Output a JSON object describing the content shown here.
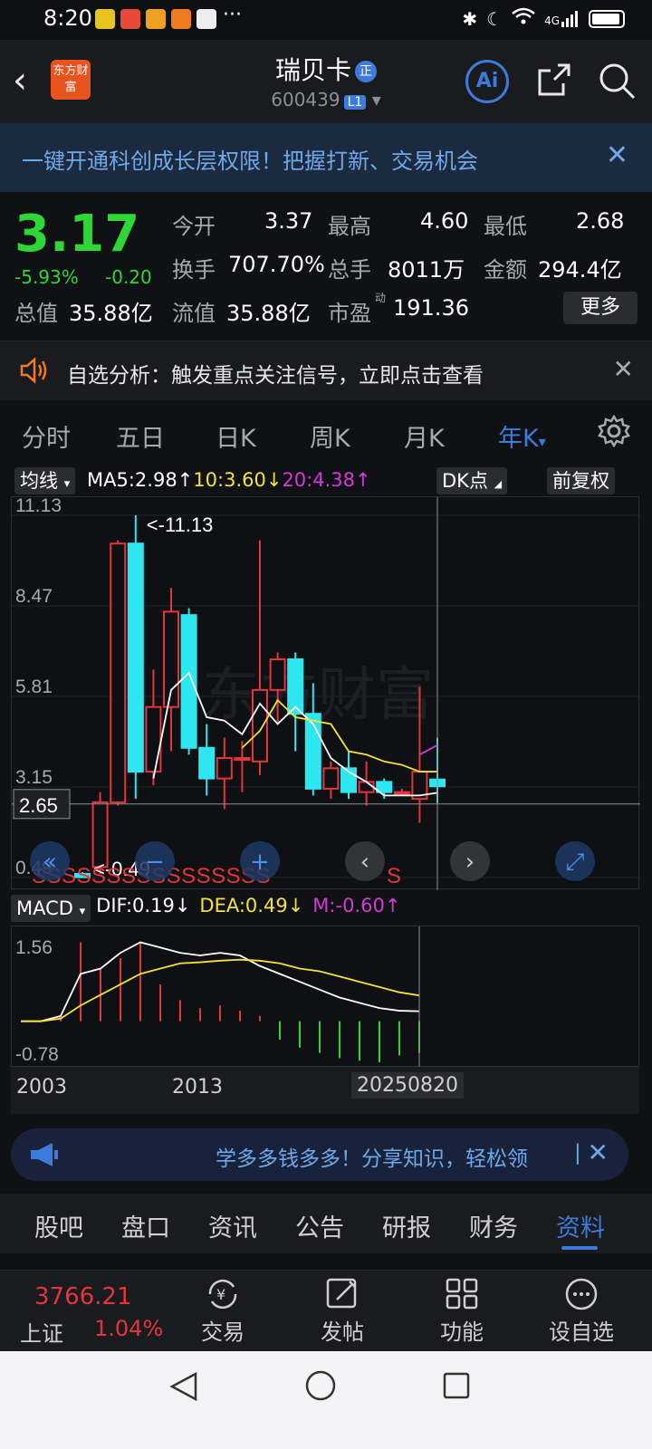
{
  "status": {
    "time": "8:20",
    "dots": "···",
    "signal": "4G"
  },
  "header": {
    "back": "‹",
    "logo": "东方财富",
    "title": "瑞贝卡",
    "zheng_badge": "正",
    "code": "600439",
    "level": "L1",
    "ai_label": "Ai"
  },
  "promo": {
    "text": "一键开通科创成长层权限！把握打新、交易机会",
    "close": "✕"
  },
  "quote": {
    "price": "3.17",
    "change_pct": "-5.93%",
    "change": "-0.20",
    "fields": [
      {
        "label": "今开",
        "value": "3.37"
      },
      {
        "label": "最高",
        "value": "4.60"
      },
      {
        "label": "最低",
        "value": "2.68"
      },
      {
        "label": "换手",
        "value": "707.70%"
      },
      {
        "label": "总手",
        "value": "8011万"
      },
      {
        "label": "金额",
        "value": "294.4亿"
      },
      {
        "label": "总值",
        "value": "35.88亿"
      },
      {
        "label": "流值",
        "value": "35.88亿"
      },
      {
        "label": "市盈",
        "value": "191.36"
      }
    ],
    "pe_sup": "动",
    "more": "更多"
  },
  "alert": {
    "text": "自选分析：触发重点关注信号，立即点击查看",
    "close": "✕"
  },
  "ktabs": [
    "分时",
    "五日",
    "日K",
    "周K",
    "月K",
    "年K"
  ],
  "ktab_active_arrow": "▾",
  "chart_toolbar": {
    "ma_button": "均线",
    "ma5": "MA5:2.98↑",
    "ma10": "10:3.60↓",
    "ma20": "20:4.38↑",
    "dk_button": "DK点",
    "adjust_button": "前复权"
  },
  "chart_data": {
    "type": "candlestick",
    "y_ticks": [
      "11.13",
      "8.47",
      "5.81",
      "3.15",
      "0.49"
    ],
    "ylim": [
      0.49,
      11.13
    ],
    "max_label": "<-11.13",
    "min_label": "<-0.49",
    "crosshair_price": "2.65",
    "candles": [
      {
        "o": 0.6,
        "c": 0.5,
        "h": 0.65,
        "l": 0.49
      },
      {
        "o": 0.8,
        "c": 2.7,
        "h": 3.0,
        "l": 0.6
      },
      {
        "o": 2.7,
        "c": 10.3,
        "h": 10.4,
        "l": 2.6
      },
      {
        "o": 10.3,
        "c": 3.6,
        "h": 11.13,
        "l": 2.8
      },
      {
        "o": 3.6,
        "c": 5.5,
        "h": 6.6,
        "l": 3.2
      },
      {
        "o": 5.5,
        "c": 8.3,
        "h": 9.0,
        "l": 4.2
      },
      {
        "o": 8.2,
        "c": 4.3,
        "h": 8.4,
        "l": 4.1
      },
      {
        "o": 4.3,
        "c": 3.4,
        "h": 5.0,
        "l": 2.9
      },
      {
        "o": 3.4,
        "c": 4.0,
        "h": 4.6,
        "l": 2.5
      },
      {
        "o": 4.0,
        "c": 4.0,
        "h": 4.5,
        "l": 3.0
      },
      {
        "o": 3.9,
        "c": 6.0,
        "h": 10.4,
        "l": 3.5
      },
      {
        "o": 6.0,
        "c": 6.9,
        "h": 7.1,
        "l": 5.0
      },
      {
        "o": 6.9,
        "c": 5.3,
        "h": 7.1,
        "l": 4.2
      },
      {
        "o": 5.3,
        "c": 3.1,
        "h": 6.2,
        "l": 2.9
      },
      {
        "o": 3.1,
        "c": 3.7,
        "h": 3.9,
        "l": 2.8
      },
      {
        "o": 3.7,
        "c": 3.0,
        "h": 4.2,
        "l": 2.8
      },
      {
        "o": 3.0,
        "c": 3.3,
        "h": 3.9,
        "l": 2.6
      },
      {
        "o": 3.3,
        "c": 3.0,
        "h": 3.4,
        "l": 2.8
      },
      {
        "o": 3.0,
        "c": 3.0,
        "h": 3.1,
        "l": 2.9
      },
      {
        "o": 2.8,
        "c": 3.6,
        "h": 6.1,
        "l": 2.1
      },
      {
        "o": 3.37,
        "c": 3.17,
        "h": 4.6,
        "l": 2.68
      }
    ],
    "ma5": [
      null,
      null,
      null,
      null,
      3.4,
      6.0,
      6.5,
      5.2,
      5.1,
      4.7,
      5.6,
      5.0,
      5.5,
      5.0,
      4.0,
      3.6,
      3.3,
      2.9,
      2.9,
      2.9,
      2.98
    ],
    "ma10": [
      null,
      null,
      null,
      null,
      null,
      null,
      null,
      null,
      null,
      4.3,
      4.8,
      5.7,
      5.2,
      5.1,
      5.0,
      4.2,
      4.1,
      3.9,
      3.8,
      3.6,
      3.6
    ],
    "ma20": [
      null,
      null,
      null,
      null,
      null,
      null,
      null,
      null,
      null,
      null,
      null,
      null,
      null,
      null,
      null,
      null,
      null,
      null,
      null,
      4.1,
      4.38
    ],
    "signal_text": "SSSSSSSSSSSSSSSS",
    "signal_last": "S",
    "overlay_icons": [
      "rewind-icon",
      "zoom-out-icon",
      "zoom-in-icon",
      "prev-icon",
      "next-icon",
      "fullscreen-icon"
    ]
  },
  "macd": {
    "button": "MACD",
    "dif": "DIF:0.19↓",
    "dea": "DEA:0.49↓",
    "m": "M:-0.60↑",
    "y_ticks": [
      "1.56",
      "-0.78"
    ],
    "ylim": [
      -0.78,
      1.56
    ],
    "dif_values": [
      0.0,
      0.0,
      0.1,
      0.9,
      1.0,
      1.3,
      1.5,
      1.4,
      1.3,
      1.25,
      1.3,
      1.25,
      1.05,
      0.9,
      0.75,
      0.6,
      0.45,
      0.35,
      0.25,
      0.2,
      0.19
    ],
    "dea_values": [
      0.0,
      0.0,
      0.05,
      0.3,
      0.5,
      0.7,
      0.9,
      1.0,
      1.1,
      1.12,
      1.15,
      1.17,
      1.15,
      1.1,
      1.0,
      0.95,
      0.85,
      0.75,
      0.65,
      0.55,
      0.49
    ],
    "m_values": [
      0.0,
      0.0,
      0.1,
      1.5,
      1.0,
      1.2,
      1.5,
      0.7,
      0.4,
      0.25,
      0.3,
      0.2,
      0.1,
      -0.35,
      -0.5,
      -0.6,
      -0.7,
      -0.75,
      -0.78,
      -0.65,
      -0.6
    ]
  },
  "xaxis": {
    "start": "2003",
    "mid": "2013",
    "date": "20250820"
  },
  "ticker": {
    "text": "学多多钱多多！分享知识，轻松领",
    "close": "✕"
  },
  "infotabs": [
    "股吧",
    "盘口",
    "资讯",
    "公告",
    "研报",
    "财务",
    "资料"
  ],
  "bottomnav": {
    "index_value": "3766.21",
    "index_name": "上证",
    "index_change": "1.04%",
    "items": [
      "交易",
      "发帖",
      "功能",
      "设自选"
    ]
  },
  "colors": {
    "up": "#e3353a",
    "down": "#2ed636",
    "cyan": "#2ee6f0",
    "accent": "#3d7bdc",
    "yellow": "#f2e33b",
    "magenta": "#d23bd6"
  }
}
